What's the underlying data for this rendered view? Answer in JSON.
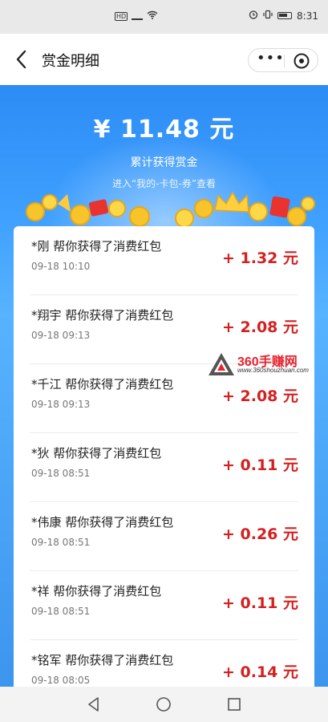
{
  "status_bar": {
    "left_icons": [
      "hd-icon",
      "signal-icon",
      "wifi-icon"
    ],
    "network_label": "HD",
    "time": "8:31"
  },
  "nav": {
    "title": "赏金明细",
    "more_label": "•••"
  },
  "summary": {
    "amount": "¥ 11.48 元",
    "label": "累计获得赏金",
    "hint": "进入“我的-卡包-券”查看"
  },
  "records": [
    {
      "title": "*刚 帮你获得了消费红包",
      "time": "09-18 10:10",
      "amount": "+ 1.32 元"
    },
    {
      "title": "*翔宇 帮你获得了消费红包",
      "time": "09-18 09:13",
      "amount": "+ 2.08 元"
    },
    {
      "title": "*千江 帮你获得了消费红包",
      "time": "09-18 09:13",
      "amount": "+ 2.08 元"
    },
    {
      "title": "*狄 帮你获得了消费红包",
      "time": "09-18 08:51",
      "amount": "+ 0.11 元"
    },
    {
      "title": "*伟康 帮你获得了消费红包",
      "time": "09-18 08:51",
      "amount": "+ 0.26 元"
    },
    {
      "title": "*祥 帮你获得了消费红包",
      "time": "09-18 08:51",
      "amount": "+ 0.11 元"
    },
    {
      "title": "*铭军 帮你获得了消费红包",
      "time": "09-18 08:05",
      "amount": "+ 0.14 元"
    }
  ],
  "watermark": {
    "brand": "360手赚网",
    "url": "www.360shouzhuan.com"
  },
  "colors": {
    "banner_blue": "#3fa0ff",
    "amount_red": "#d42020",
    "card_bg": "#ffffff"
  }
}
